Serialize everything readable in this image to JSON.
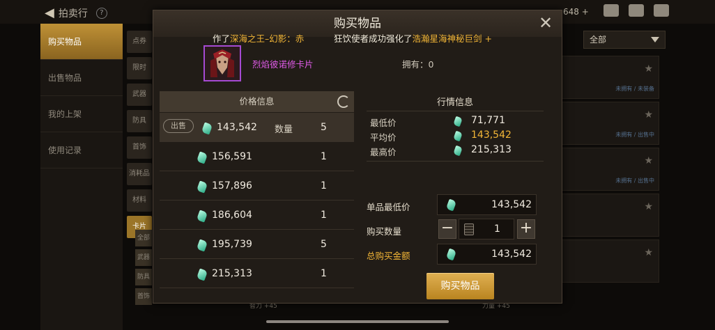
{
  "background": {
    "back_label": "拍卖行",
    "help_label": "?",
    "currency_partial": "648 +",
    "sidebar": [
      "购买物品",
      "出售物品",
      "我的上架",
      "使用记录"
    ],
    "categories": [
      "点券",
      "限时",
      "武器",
      "防具",
      "首饰",
      "消耗品",
      "材料",
      "卡片"
    ],
    "subcategories": [
      "全部",
      "武器",
      "防具",
      "首饰"
    ],
    "filter_label": "全部",
    "bottom_stats": [
      "智力 +45",
      "力量 +45"
    ],
    "row_meta": [
      "未拥有 / 未装备",
      "未拥有 / 出售中",
      "未拥有 / 出售中"
    ]
  },
  "modal": {
    "title": "购买物品",
    "ticker": {
      "left_prefix": "作了",
      "left_item": "深海之王–幻影：赤",
      "right_text": "狂饮使者成功强化了",
      "right_item": "浩瀚星海神秘巨剑 +"
    },
    "item": {
      "name": "烈焰彼诺修卡片",
      "owned_label": "拥有：0"
    },
    "price_info": {
      "header": "价格信息",
      "sell_tag": "出售",
      "qty_label": "数量",
      "rows": [
        {
          "price": "143,542",
          "qty": "5"
        },
        {
          "price": "156,591",
          "qty": "1"
        },
        {
          "price": "157,896",
          "qty": "1"
        },
        {
          "price": "186,604",
          "qty": "1"
        },
        {
          "price": "195,739",
          "qty": "5"
        },
        {
          "price": "215,313",
          "qty": "1"
        }
      ]
    },
    "market_info": {
      "header": "行情信息",
      "rows": [
        {
          "label": "最低价",
          "value": "71,771"
        },
        {
          "label": "平均价",
          "value": "143,542"
        },
        {
          "label": "最高价",
          "value": "215,313"
        }
      ]
    },
    "purchase": {
      "unit_price_label": "单品最低价",
      "unit_price": "143,542",
      "qty_label": "购买数量",
      "qty": "1",
      "total_label": "总购买金额",
      "total": "143,542",
      "buy_label": "购买物品",
      "minus": "−",
      "plus": "+"
    },
    "close": "✕"
  }
}
